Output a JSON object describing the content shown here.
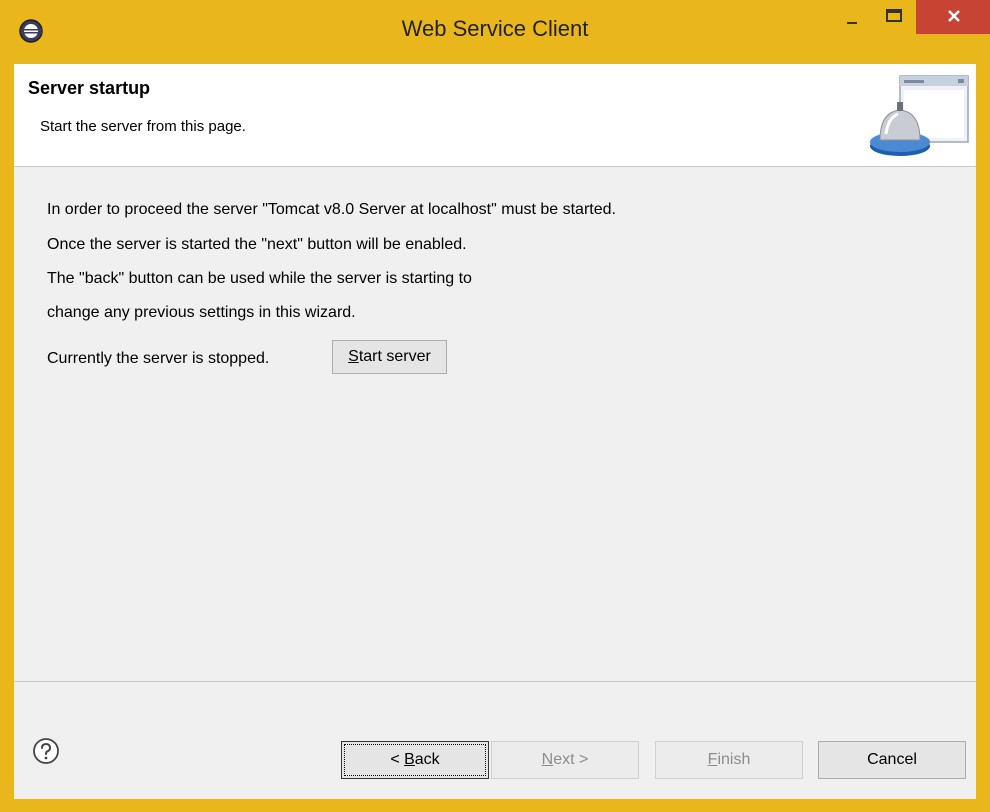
{
  "window": {
    "title": "Web Service Client",
    "accent_color": "#e9b71b",
    "close_color": "#c74333",
    "icons": [
      "app-icon",
      "minimize-icon",
      "maximize-icon",
      "close-icon"
    ]
  },
  "banner": {
    "title": "Server startup",
    "description": "Start the server from this page.",
    "graphic": "server-bell-icon"
  },
  "body": {
    "lines": [
      "In order to proceed the server \"Tomcat v8.0 Server at localhost\" must be started.",
      "Once the server is started the \"next\" button will be enabled.",
      "The \"back\" button can be used while the server is starting to",
      "change any previous settings in this wizard."
    ],
    "status_text": "Currently the server is stopped.",
    "start_button": {
      "mnemonic": "S",
      "rest": "tart server"
    }
  },
  "footer": {
    "help_icon": "help-icon",
    "back": {
      "prefix": "< ",
      "mnemonic": "B",
      "rest": "ack"
    },
    "next": {
      "mnemonic": "N",
      "rest": "ext >",
      "enabled": false
    },
    "finish": {
      "mnemonic": "F",
      "rest": "inish",
      "enabled": false
    },
    "cancel": "Cancel"
  }
}
